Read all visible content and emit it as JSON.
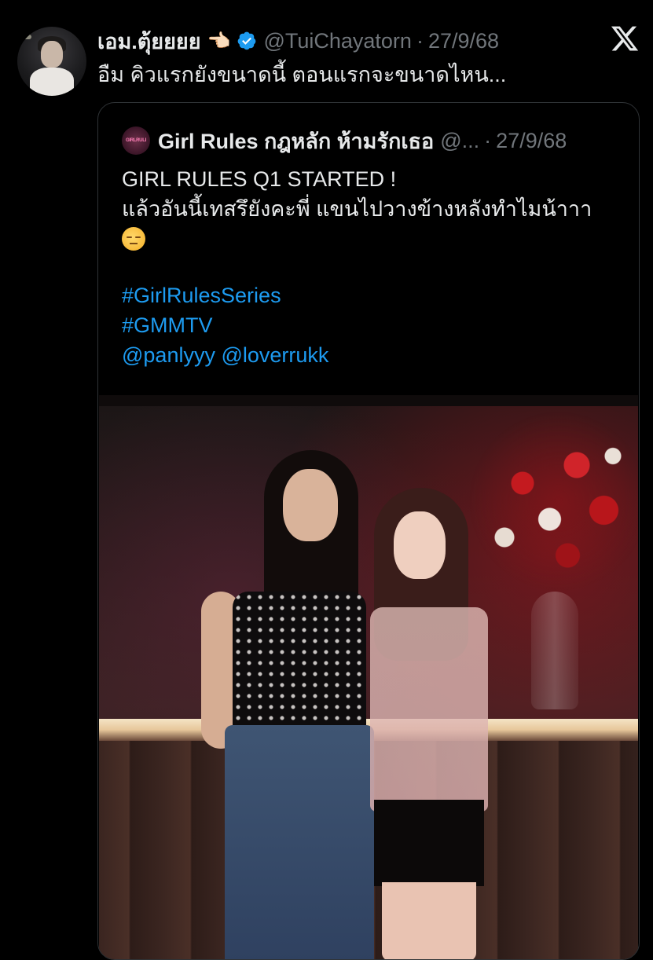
{
  "tweet": {
    "display_name": "เอม.ตุ้ยยยย",
    "name_emoji": "👈🏻",
    "handle": "@TuiChayatorn",
    "separator": "·",
    "date": "27/9/68",
    "text": "อืม คิวแรกยังขนาดนี้ ตอนแรกจะขนาดไหน...",
    "verified_color": "#1d9bf0"
  },
  "quote": {
    "avatar_text": "GIRLRULES",
    "display_name": "Girl Rules กฎหลัก ห้ามรักเธอ",
    "handle": "@...",
    "separator": "·",
    "date": "27/9/68",
    "line1": "GIRL RULES Q1 STARTED !",
    "line2": "แล้วอันนี้เทสรึยังคะพี่ แขนไปวางข้างหลังทำไมน้าาา",
    "emoji_name": "pensive-face-emoji",
    "hashtag1": "#GirlRulesSeries",
    "hashtag2": "#GMMTV",
    "mentions": "@panlyyy @loverrukk",
    "link_color": "#1d9bf0"
  },
  "icons": {
    "brand": "x-logo-icon",
    "verified": "verified-badge-icon"
  }
}
